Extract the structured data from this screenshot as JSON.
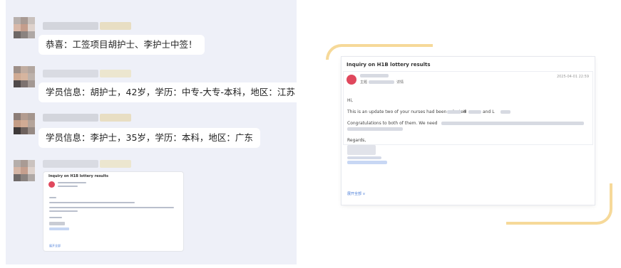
{
  "chat": {
    "messages": [
      {
        "text": "恭喜：工签项目胡护士、李护士中签！"
      },
      {
        "text": "学员信息：胡护士，42岁，学历：中专-大专-本科，地区：江苏"
      },
      {
        "text": "学员信息：李护士，35岁，学历：本科，地区：广东"
      }
    ],
    "attachment": {
      "subject": "Inquiry on H1B lottery results",
      "footer": "展开全部"
    }
  },
  "email": {
    "subject": "Inquiry on H1B lottery results",
    "sender_label": "主题",
    "sender_tag": "详情",
    "date": "2025-04-01 22:59",
    "greeting": "Hi,",
    "line1": "This is an update two of your nurses had been selected",
    "line1_mid": "H",
    "line1_and": "and L",
    "line2": "Congratulations to both of them. We need",
    "regards": "Regards,",
    "footer_link": "展开全部 ∨"
  },
  "colors": {
    "chat_bg": "#eef0f8",
    "accent_red": "#e0485d",
    "deco_gold": "#f6d999",
    "link_blue": "#4a7dd8"
  }
}
